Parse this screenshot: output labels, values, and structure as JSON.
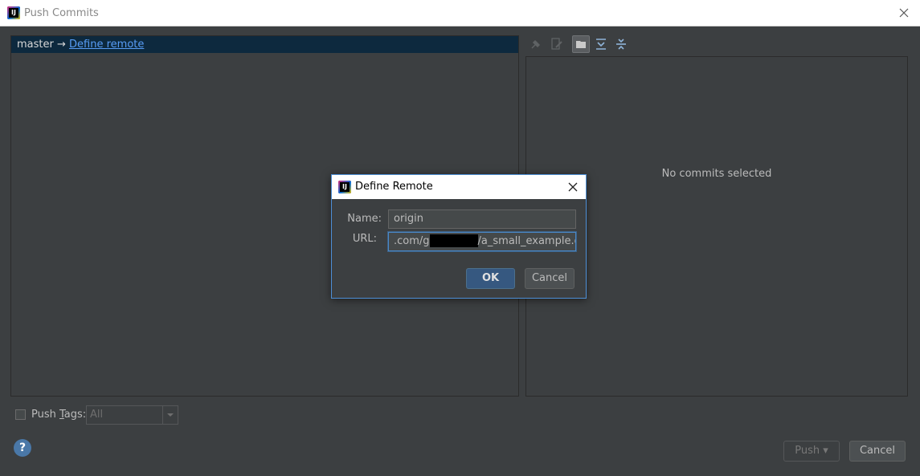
{
  "window": {
    "title": "Push Commits",
    "app_logo_text": "IJ"
  },
  "branch": {
    "name": "master",
    "arrow": "→",
    "target_link": "Define remote"
  },
  "details": {
    "empty_message": "No commits selected"
  },
  "push_tags": {
    "label_prefix": "Push ",
    "label_mnemonic": "T",
    "label_suffix": "ags:",
    "selected": "All"
  },
  "footer": {
    "help_label": "?",
    "push_label": "Push ▾",
    "cancel_label": "Cancel"
  },
  "dialog": {
    "title": "Define Remote",
    "name_label": "Name:",
    "name_value": "origin",
    "url_label": "URL:",
    "url_value_prefix": ".com/g",
    "url_value_suffix": "/a_small_example.git",
    "ok_label": "OK",
    "cancel_label": "Cancel"
  }
}
